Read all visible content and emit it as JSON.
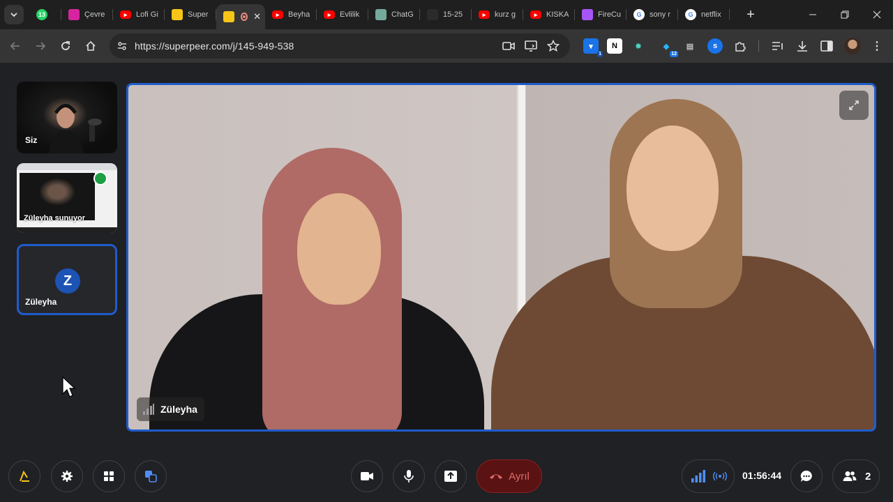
{
  "browser": {
    "tabs": [
      {
        "title": "",
        "favicon": "whatsapp-icon",
        "badge": "13",
        "color": "#25d366"
      },
      {
        "title": "Çevre",
        "favicon": "instagram-icon",
        "color": "#d6249f"
      },
      {
        "title": "Lofi Gi",
        "favicon": "youtube-icon",
        "color": "#ff0000"
      },
      {
        "title": "Super",
        "favicon": "superpeer-icon",
        "color": "#f5c518"
      },
      {
        "title": "",
        "favicon": "superpeer-icon",
        "color": "#f5c518",
        "active": true
      },
      {
        "title": "Beyha",
        "favicon": "youtube-icon",
        "color": "#ff0000"
      },
      {
        "title": "Evlilik",
        "favicon": "youtube-icon",
        "color": "#ff0000"
      },
      {
        "title": "ChatG",
        "favicon": "chatgpt-icon",
        "color": "#74aa9c"
      },
      {
        "title": "15-25",
        "favicon": "app-icon",
        "color": "#2b2b2b"
      },
      {
        "title": "kurz g",
        "favicon": "youtube-icon",
        "color": "#ff0000"
      },
      {
        "title": "KISKA",
        "favicon": "youtube-icon",
        "color": "#ff0000"
      },
      {
        "title": "FireCu",
        "favicon": "firecut-icon",
        "color": "#a855f7"
      },
      {
        "title": "sony r",
        "favicon": "google-icon",
        "color": "#ffffff"
      },
      {
        "title": "netflix",
        "favicon": "google-icon",
        "color": "#ffffff"
      }
    ],
    "url": "https://superpeer.com/j/145-949-538",
    "extension_badge": "12"
  },
  "meeting": {
    "self_label": "Siz",
    "screenshare_caption": "Züleyha sunuyor",
    "participant_name": "Züleyha",
    "participant_initial": "Z",
    "main_speaker": "Züleyha",
    "leave_label": "Ayrıl",
    "timer": "01:56:44",
    "participant_count": "2"
  },
  "colors": {
    "accent": "#1f5ccc",
    "leave_bg": "#5a1212",
    "leave_text": "#e06a6a",
    "signal": "#4f8ef7"
  }
}
